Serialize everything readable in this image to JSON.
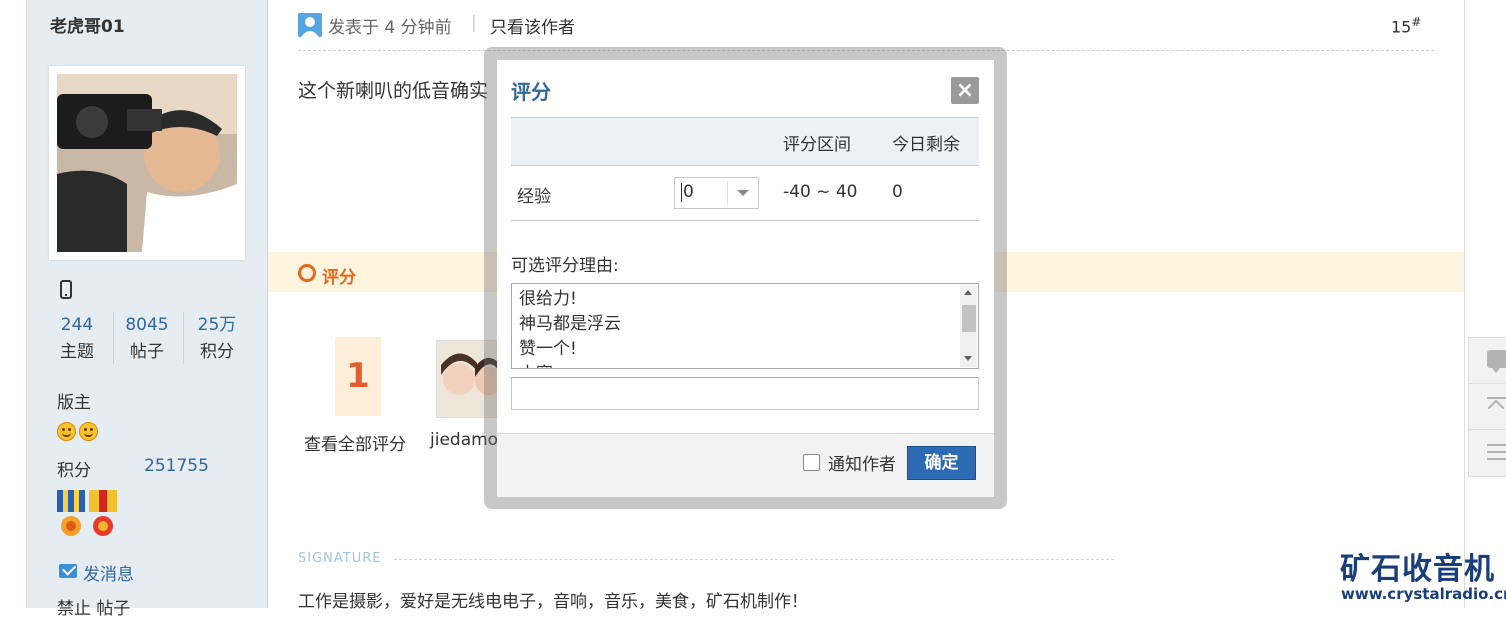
{
  "author": {
    "name": "老虎哥01",
    "stats": [
      {
        "value": "244",
        "label": "主题"
      },
      {
        "value": "8045",
        "label": "帖子"
      },
      {
        "value": "25万",
        "label": "积分"
      }
    ],
    "role": "版主",
    "points_label": "积分",
    "points_value": "251755",
    "send_message": "发消息",
    "ban_post": "禁止 帖子"
  },
  "post": {
    "posted_at": "发表于 4 分钟前",
    "separator": "|",
    "only_author": "只看该作者",
    "floor": "15",
    "floor_suffix": "#",
    "content": "这个新喇叭的低音确实"
  },
  "rating": {
    "section_label": "评分",
    "count": "1",
    "view_all": "查看全部评分",
    "rater_name": "jiedamot"
  },
  "signature": {
    "label": "SIGNATURE",
    "text": "工作是摄影，爱好是无线电电子，音响，音乐，美食，矿石机制作！"
  },
  "brand": {
    "name": "矿石收音机",
    "url": "www.crystalradio.cn"
  },
  "dialog": {
    "title": "评分",
    "close_label": "×",
    "headers": [
      "",
      "",
      "评分区间",
      "今日剩余"
    ],
    "row": {
      "name": "经验",
      "score_value": "0",
      "range": "-40 ~ 40",
      "remaining": "0"
    },
    "reason_label": "可选评分理由:",
    "reasons": [
      "很给力!",
      "神马都是浮云",
      "赞一个!",
      "山寨"
    ],
    "reason_input_value": "",
    "notify_label": "通知作者",
    "confirm_label": "确定"
  },
  "colors": {
    "link": "#336699",
    "accent_orange": "#e6691c",
    "button_blue": "#2c6ab3",
    "sidebar_bg": "#e5edf2"
  },
  "icons": {
    "post": "user-icon",
    "phone": "mobile-icon",
    "message": "envelope-icon",
    "float": [
      "comment-icon",
      "back-to-top-icon",
      "list-icon"
    ]
  }
}
